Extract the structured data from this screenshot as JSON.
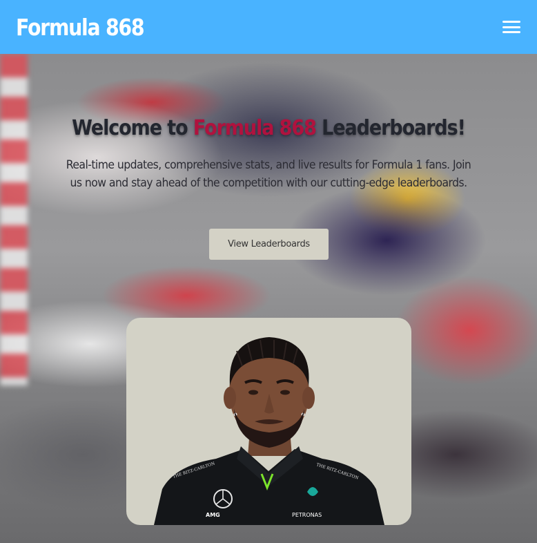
{
  "navbar": {
    "brand": "Formula 868",
    "menu_icon": "hamburger-menu-icon",
    "background_color": "#49b3ff"
  },
  "hero": {
    "background_image": "blurred-f1-race-cars-photo",
    "title_prefix": "Welcome to ",
    "title_accent": "Formula 868",
    "title_suffix": " Leaderboards!",
    "accent_color": "#b0123e",
    "subtitle": "Real-time updates, comprehensive stats, and live results for Formula 1 fans. Join us now and stay ahead of the competition with our cutting-edge leaderboards.",
    "cta_label": "View Leaderboards"
  },
  "driver_card": {
    "image": "racing-driver-portrait-photo",
    "suit_logos": [
      "THE RITZ-CARLTON",
      "AMG",
      "PETRONAS",
      "THE RITZ-CARLTON"
    ]
  }
}
